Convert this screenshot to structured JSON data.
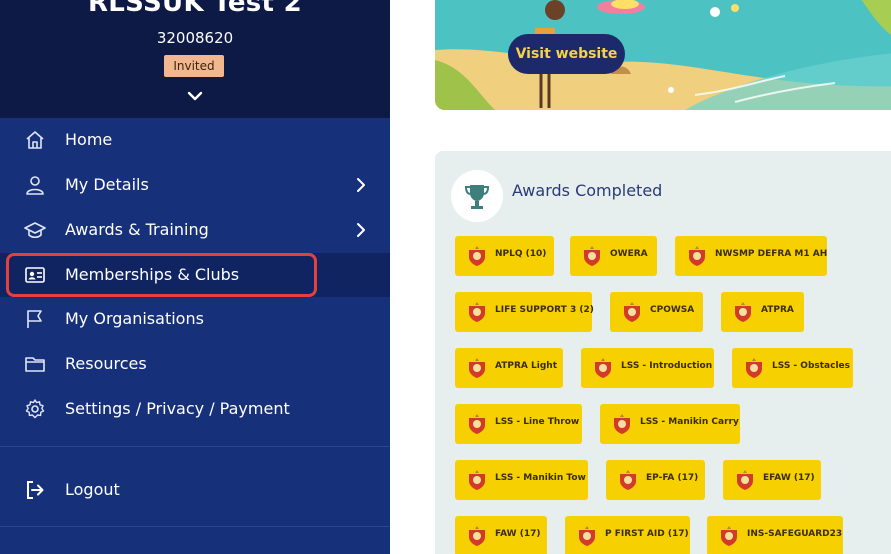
{
  "user": {
    "name": "RLSSUK Test 2",
    "id": "32008620",
    "status_badge": "Invited"
  },
  "nav": {
    "items": [
      {
        "label": "Home",
        "icon": "home-icon"
      },
      {
        "label": "My Details",
        "icon": "user-icon"
      },
      {
        "label": "Awards & Training",
        "icon": "graduation-cap-icon"
      },
      {
        "label": "Memberships & Clubs",
        "icon": "id-card-icon"
      },
      {
        "label": "My Organisations",
        "icon": "flag-icon"
      },
      {
        "label": "Resources",
        "icon": "folder-icon"
      },
      {
        "label": "Settings / Privacy / Payment",
        "icon": "gear-icon"
      }
    ],
    "logout_label": "Logout",
    "active_item": "Memberships & Clubs"
  },
  "banner": {
    "visit_button_label": "Visit website"
  },
  "awards": {
    "title": "Awards Completed",
    "items": [
      "NPLQ (10)",
      "OWERA",
      "NWSMP DEFRA M1 AH",
      "LIFE SUPPORT 3 (2)",
      "CPOWSA",
      "ATPRA",
      "ATPRA Light",
      "LSS - Introduction",
      "LSS - Obstacles",
      "LSS - Line Throw",
      "LSS - Manikin Carry",
      "LSS - Manikin Tow",
      "EP-FA (17)",
      "EFAW (17)",
      "FAW (17)",
      "P FIRST AID (17)",
      "INS-SAFEGUARD23"
    ]
  },
  "colors": {
    "sidebar_bg": "#17307a",
    "sidebar_header_bg": "#0c1a45",
    "highlight": "#e5403f",
    "award_chip": "#f6d000",
    "button_bg": "#1c2a6b",
    "button_text": "#f6d24a"
  }
}
